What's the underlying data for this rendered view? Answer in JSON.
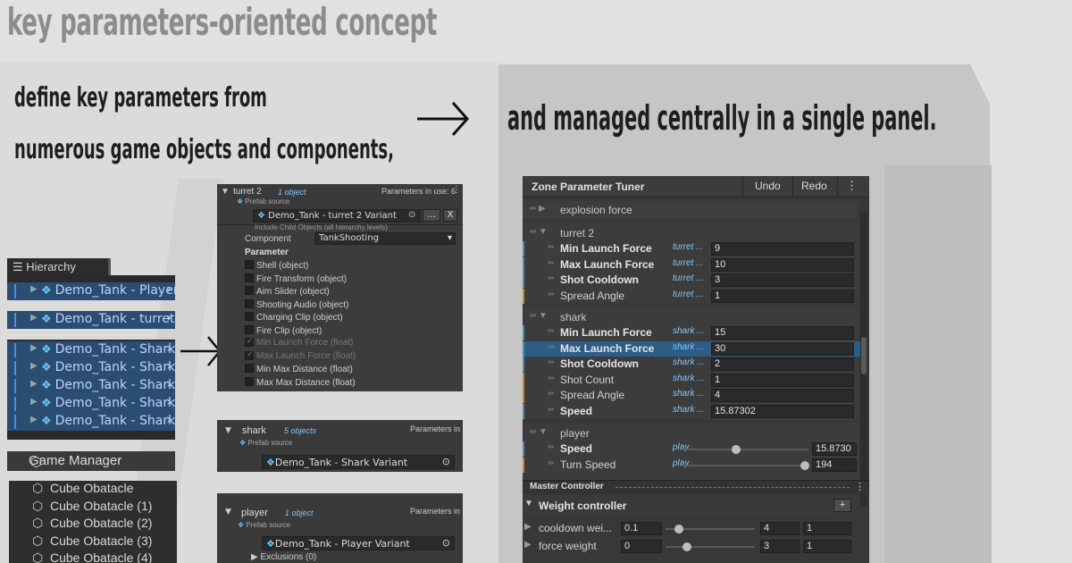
{
  "texts": {
    "headline": "key parameters-oriented concept",
    "sub1": "define key parameters from",
    "sub2": "numerous game objects and components,",
    "sub3": "and managed centrally in a single panel."
  },
  "hierarchy": {
    "title": "Hierarchy",
    "items": [
      "Demo_Tank - Player",
      "Demo_Tank - turret 2",
      "Demo_Tank - Shark",
      "Demo_Tank - Shark",
      "Demo_Tank - Shark",
      "Demo_Tank - Shark",
      "Demo_Tank - Shark"
    ],
    "game_manager": "Game Manager",
    "cubes": [
      "Cube Obatacle",
      "Cube Obatacle (1)",
      "Cube Obatacle (2)",
      "Cube Obatacle (3)",
      "Cube Obatacle (4)"
    ]
  },
  "turret_panel": {
    "name": "turret 2",
    "count": "1 object",
    "params_in_use": "Parameters in use: 6",
    "prefab_source": "Prefab source",
    "prefab": "Demo_Tank - turret 2 Variant",
    "include_child": "Include Child Objects (all hierarchy levels)",
    "component_label": "Component",
    "component_value": "TankShooting",
    "parameter_label": "Parameter",
    "params": [
      {
        "label": "Shell (object)",
        "checked": false
      },
      {
        "label": "Fire Transform (object)",
        "checked": false
      },
      {
        "label": "Aim Slider (object)",
        "checked": false
      },
      {
        "label": "Shooting Audio (object)",
        "checked": false
      },
      {
        "label": "Charging Clip (object)",
        "checked": false
      },
      {
        "label": "Fire Clip (object)",
        "checked": false
      },
      {
        "label": "Min Launch Force (float)",
        "checked": true
      },
      {
        "label": "Max Launch Force (float)",
        "checked": true
      },
      {
        "label": "Min Max Distance (float)",
        "checked": false
      },
      {
        "label": "Max Max Distance (float)",
        "checked": false
      }
    ],
    "btn_dots": "...",
    "btn_x": "X"
  },
  "shark_panel": {
    "name": "shark",
    "count": "5 objects",
    "params": "Parameters in",
    "prefab_source": "Prefab source",
    "prefab": "Demo_Tank - Shark Variant"
  },
  "player_panel": {
    "name": "player",
    "count": "1 object",
    "params": "Parameters in",
    "prefab_source": "Prefab source",
    "prefab": "Demo_Tank - Player Variant",
    "exclusions": "Exclusions (0)"
  },
  "zpt": {
    "title": "Zone Parameter Tuner",
    "undo": "Undo",
    "redo": "Redo",
    "explosion": "explosion force",
    "turret_group": "turret 2",
    "turret_rows": [
      {
        "name": "Min Launch Force",
        "src": "turret ...",
        "val": "9",
        "bold": true
      },
      {
        "name": "Max Launch Force",
        "src": "turret ...",
        "val": "10",
        "bold": true
      },
      {
        "name": "Shot Cooldown",
        "src": "turret ...",
        "val": "3",
        "bold": true
      },
      {
        "name": "Spread Angle",
        "src": "turret ...",
        "val": "1",
        "bold": false
      }
    ],
    "shark_group": "shark",
    "shark_rows": [
      {
        "name": "Min Launch Force",
        "src": "shark ...",
        "val": "15",
        "bold": true
      },
      {
        "name": "Max Launch Force",
        "src": "shark ...",
        "val": "30",
        "bold": true
      },
      {
        "name": "Shot Cooldown",
        "src": "shark ...",
        "val": "2",
        "bold": true
      },
      {
        "name": "Shot Count",
        "src": "shark ...",
        "val": "1",
        "bold": false
      },
      {
        "name": "Spread Angle",
        "src": "shark ...",
        "val": "4",
        "bold": false
      },
      {
        "name": "Speed",
        "src": "shark ...",
        "val": "15.87302",
        "bold": true
      }
    ],
    "player_group": "player",
    "player_rows": [
      {
        "name": "Speed",
        "src": "play...",
        "val": "15.8730",
        "bold": true,
        "level": 0.4
      },
      {
        "name": "Turn Speed",
        "src": "play...",
        "val": "194",
        "bold": false,
        "level": 0.97
      }
    ],
    "master": "Master Controller",
    "weight": "Weight controller",
    "weight_rows": [
      {
        "name": "cooldown wei...",
        "v1": "0.1",
        "v2": "4",
        "v3": "1",
        "level": 0.1
      },
      {
        "name": "force weight",
        "v1": "0",
        "v2": "3",
        "v3": "1",
        "level": 0.2
      }
    ],
    "add": "+"
  },
  "colors": {
    "selection": "#2c5d87",
    "accent": "#4a90e2",
    "source": "#82c7f5"
  }
}
